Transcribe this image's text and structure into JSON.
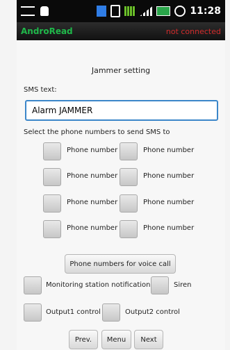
{
  "status_bar": {
    "time": "11:28"
  },
  "app": {
    "title": "AndroRead",
    "connection_status": "not connected"
  },
  "screen": {
    "heading": "Jammer setting",
    "sms_text_label": "SMS text:",
    "sms_text_value": "Alarm JAMMER",
    "select_label": "Select the phone numbers to send SMS to",
    "phone_checkboxes": [
      {
        "label": "Phone number",
        "checked": false
      },
      {
        "label": "Phone number",
        "checked": false
      },
      {
        "label": "Phone number",
        "checked": false
      },
      {
        "label": "Phone number",
        "checked": false
      },
      {
        "label": "Phone number",
        "checked": false
      },
      {
        "label": "Phone number",
        "checked": false
      },
      {
        "label": "Phone number",
        "checked": false
      },
      {
        "label": "Phone number",
        "checked": false
      }
    ],
    "voice_call_button": "Phone numbers for voice call",
    "options": [
      {
        "label": "Monitoring station notification",
        "checked": false
      },
      {
        "label": "Siren",
        "checked": false
      },
      {
        "label": "Output1 control",
        "checked": false
      },
      {
        "label": "Output2 control",
        "checked": false
      }
    ],
    "nav": {
      "prev": "Prev.",
      "menu": "Menu",
      "next": "Next"
    }
  }
}
